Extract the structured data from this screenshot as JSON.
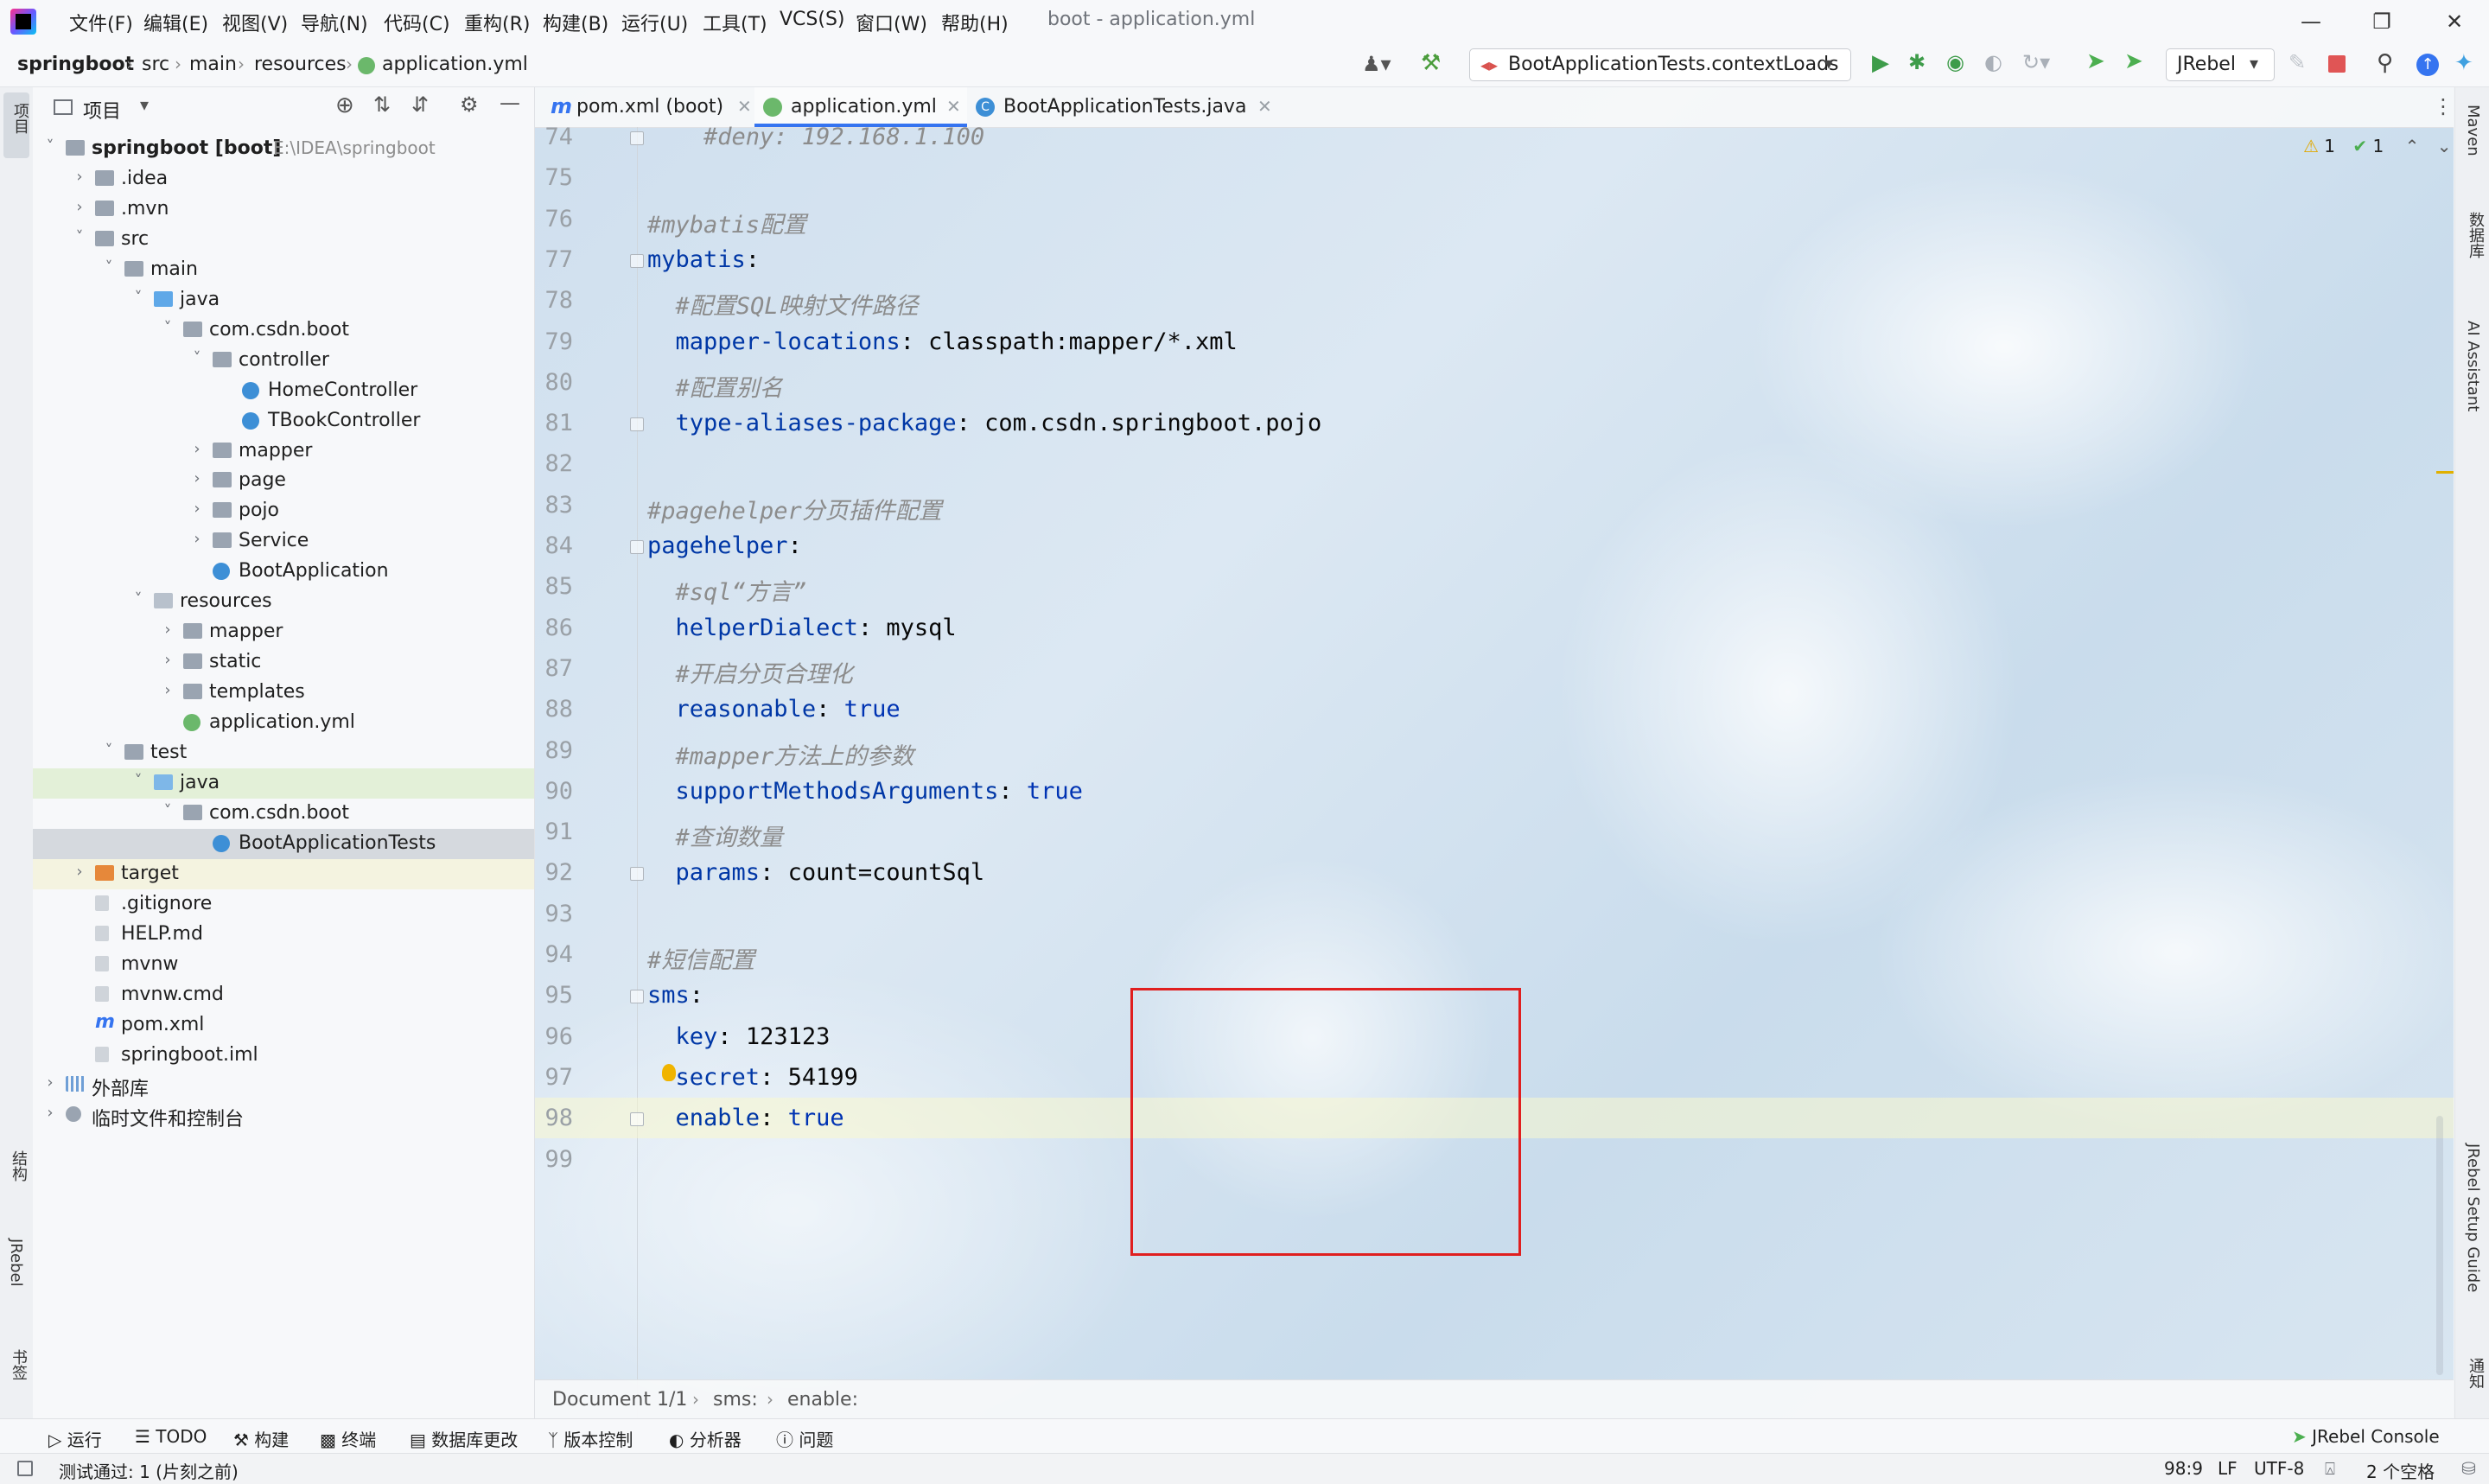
{
  "menu": {
    "items": [
      "文件(F)",
      "编辑(E)",
      "视图(V)",
      "导航(N)",
      "代码(C)",
      "重构(R)",
      "构建(B)",
      "运行(U)",
      "工具(T)",
      "VCS(S)",
      "窗口(W)",
      "帮助(H)"
    ],
    "window_title": "boot - application.yml"
  },
  "breadcrumb": [
    "springboot",
    "src",
    "main",
    "resources",
    "application.yml"
  ],
  "run_config": "BootApplicationTests.contextLoads",
  "jrebel_label": "JRebel",
  "project_panel": {
    "title": "项目",
    "tree": [
      {
        "label": "springboot [boot]",
        "path": "E:\\IDEA\\springboot",
        "icon": "folder-icon"
      },
      {
        "label": ".idea",
        "icon": "folder-icon"
      },
      {
        "label": ".mvn",
        "icon": "folder-icon"
      },
      {
        "label": "src",
        "icon": "folder-icon"
      },
      {
        "label": "main",
        "icon": "folder-icon"
      },
      {
        "label": "java",
        "icon": "source-folder-icon"
      },
      {
        "label": "com.csdn.boot",
        "icon": "package-icon"
      },
      {
        "label": "controller",
        "icon": "package-icon"
      },
      {
        "label": "HomeController",
        "icon": "class-icon"
      },
      {
        "label": "TBookController",
        "icon": "class-icon"
      },
      {
        "label": "mapper",
        "icon": "package-icon"
      },
      {
        "label": "page",
        "icon": "package-icon"
      },
      {
        "label": "pojo",
        "icon": "package-icon"
      },
      {
        "label": "Service",
        "icon": "package-icon"
      },
      {
        "label": "BootApplication",
        "icon": "spring-class-icon"
      },
      {
        "label": "resources",
        "icon": "resources-folder-icon"
      },
      {
        "label": "mapper",
        "icon": "folder-icon"
      },
      {
        "label": "static",
        "icon": "folder-icon"
      },
      {
        "label": "templates",
        "icon": "folder-icon"
      },
      {
        "label": "application.yml",
        "icon": "yaml-file-icon"
      },
      {
        "label": "test",
        "icon": "folder-icon"
      },
      {
        "label": "java",
        "icon": "test-folder-icon"
      },
      {
        "label": "com.csdn.boot",
        "icon": "package-icon"
      },
      {
        "label": "BootApplicationTests",
        "icon": "test-class-icon"
      },
      {
        "label": "target",
        "icon": "excluded-folder-icon"
      },
      {
        "label": ".gitignore",
        "icon": "file-icon"
      },
      {
        "label": "HELP.md",
        "icon": "markdown-file-icon"
      },
      {
        "label": "mvnw",
        "icon": "file-icon"
      },
      {
        "label": "mvnw.cmd",
        "icon": "file-icon"
      },
      {
        "label": "pom.xml",
        "icon": "maven-file-icon"
      },
      {
        "label": "springboot.iml",
        "icon": "file-icon"
      },
      {
        "label": "外部库",
        "icon": "library-icon"
      },
      {
        "label": "临时文件和控制台",
        "icon": "scratch-icon"
      }
    ]
  },
  "tabs": [
    {
      "label": "pom.xml (boot)",
      "icon": "maven-icon"
    },
    {
      "label": "application.yml",
      "icon": "yaml-icon",
      "active": true
    },
    {
      "label": "BootApplicationTests.java",
      "icon": "class-icon"
    }
  ],
  "inspection": {
    "warnings": "1",
    "ok": "1"
  },
  "code_lines": [
    {
      "n": "74",
      "text": "    #deny: 192.168.1.100"
    },
    {
      "n": "75",
      "text": ""
    },
    {
      "n": "76",
      "text": "#mybatis配置"
    },
    {
      "n": "77",
      "text": "mybatis:"
    },
    {
      "n": "78",
      "text": "  #配置SQL映射文件路径"
    },
    {
      "n": "79",
      "text": "  mapper-locations: classpath:mapper/*.xml"
    },
    {
      "n": "80",
      "text": "  #配置别名"
    },
    {
      "n": "81",
      "text": "  type-aliases-package: com.csdn.springboot.pojo"
    },
    {
      "n": "82",
      "text": ""
    },
    {
      "n": "83",
      "text": "#pagehelper分页插件配置"
    },
    {
      "n": "84",
      "text": "pagehelper:"
    },
    {
      "n": "85",
      "text": "  #sql“方言”"
    },
    {
      "n": "86",
      "text": "  helperDialect: mysql"
    },
    {
      "n": "87",
      "text": "  #开启分页合理化"
    },
    {
      "n": "88",
      "text": "  reasonable: true"
    },
    {
      "n": "89",
      "text": "  #mapper方法上的参数"
    },
    {
      "n": "90",
      "text": "  supportMethodsArguments: true"
    },
    {
      "n": "91",
      "text": "  #查询数量"
    },
    {
      "n": "92",
      "text": "  params: count=countSql"
    },
    {
      "n": "93",
      "text": ""
    },
    {
      "n": "94",
      "text": "#短信配置"
    },
    {
      "n": "95",
      "text": "sms:"
    },
    {
      "n": "96",
      "text": "  key: 123123"
    },
    {
      "n": "97",
      "text": "  secret: 54199"
    },
    {
      "n": "98",
      "text": "  enable: true"
    },
    {
      "n": "99",
      "text": ""
    }
  ],
  "editor_breadcrumb": [
    "Document 1/1",
    "sms:",
    "enable:"
  ],
  "left_strip": [
    "项目",
    "结构",
    "JRebel",
    "书签"
  ],
  "right_strip": [
    "Maven",
    "数据库",
    "AI Assistant",
    "JRebel Setup Guide",
    "通知"
  ],
  "bottom_tools": [
    "运行",
    "TODO",
    "构建",
    "终端",
    "数据库更改",
    "版本控制",
    "分析器",
    "问题"
  ],
  "jrebel_console": "JRebel Console",
  "status": {
    "message": "测试通过: 1 (片刻之前)",
    "position": "98:9",
    "line_sep": "LF",
    "encoding": "UTF-8",
    "indent": "2 个空格"
  },
  "colors": {
    "key": "#0037a6",
    "comment": "#8c8c8c",
    "highlight_box": "#e01f1f",
    "accent": "#3574f0"
  }
}
